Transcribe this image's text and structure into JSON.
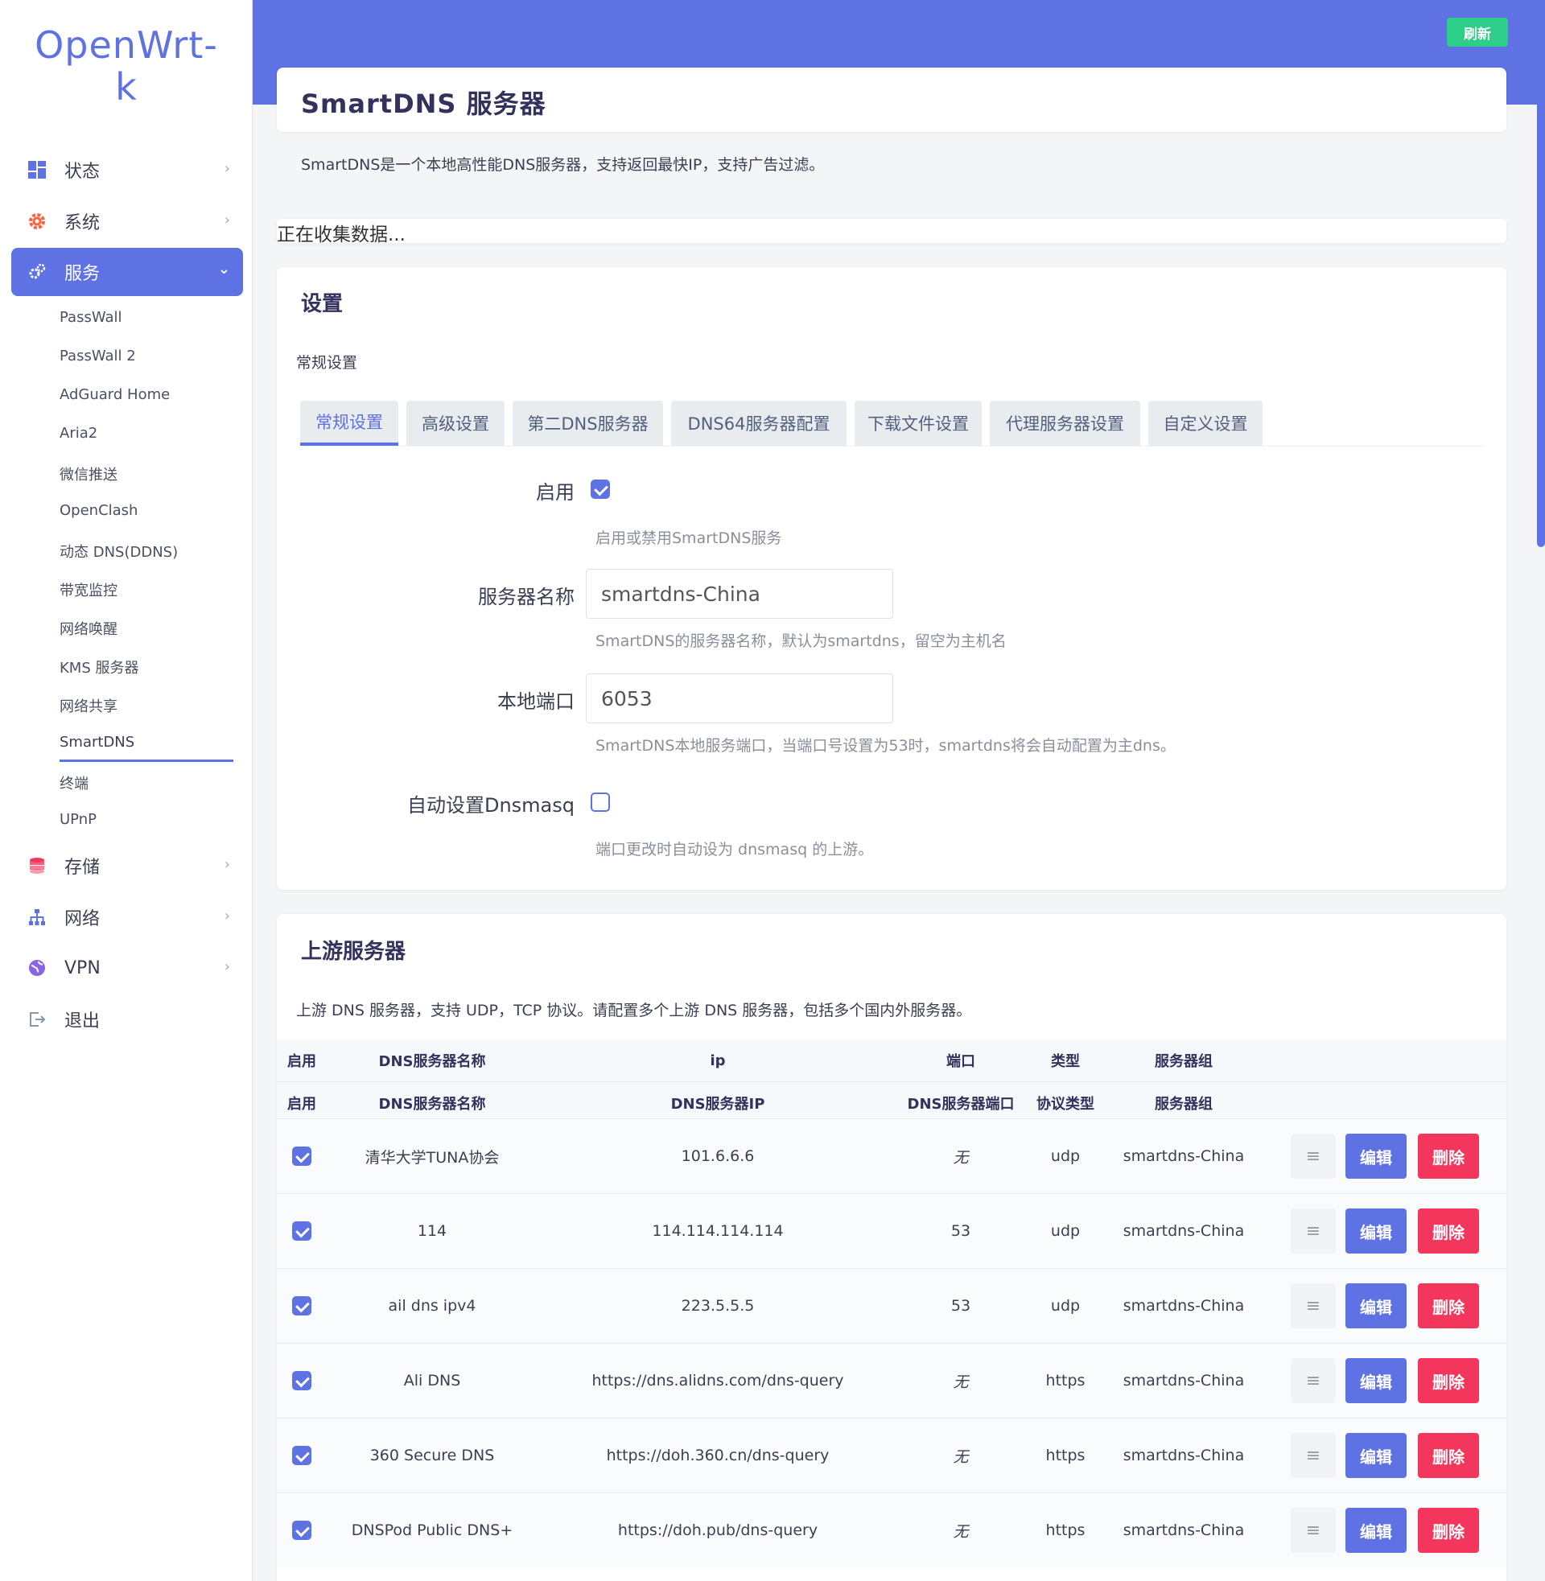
{
  "brand": {
    "line1": "OpenWrt-",
    "line2": "k"
  },
  "nav": {
    "status": "状态",
    "system": "系统",
    "services": "服务",
    "storage": "存储",
    "network": "网络",
    "vpn": "VPN",
    "logout": "退出",
    "services_sub": [
      "PassWall",
      "PassWall 2",
      "AdGuard Home",
      "Aria2",
      "微信推送",
      "OpenClash",
      "动态 DNS(DDNS)",
      "带宽监控",
      "网络唤醒",
      "KMS 服务器",
      "网络共享",
      "SmartDNS",
      "终端",
      "UPnP"
    ]
  },
  "header": {
    "refresh_label": "刷新"
  },
  "page": {
    "title": "SmartDNS 服务器",
    "description": "SmartDNS是一个本地高性能DNS服务器，支持返回最快IP，支持广告过滤。",
    "status": "正在收集数据..."
  },
  "settings": {
    "title": "设置",
    "subtitle": "常规设置",
    "tabs": [
      "常规设置",
      "高级设置",
      "第二DNS服务器",
      "DNS64服务器配置",
      "下载文件设置",
      "代理服务器设置",
      "自定义设置"
    ],
    "active_tab": "常规设置",
    "enable_label": "启用",
    "enable_checked": true,
    "enable_hint": "启用或禁用SmartDNS服务",
    "server_name_label": "服务器名称",
    "server_name_value": "smartdns-China",
    "server_name_hint": "SmartDNS的服务器名称，默认为smartdns，留空为主机名",
    "port_label": "本地端口",
    "port_value": "6053",
    "port_hint": "SmartDNS本地服务端口，当端口号设置为53时，smartdns将会自动配置为主dns。",
    "dnsmasq_label": "自动设置Dnsmasq",
    "dnsmasq_checked": false,
    "dnsmasq_hint": "端口更改时自动设为 dnsmasq 的上游。"
  },
  "upstream": {
    "title": "上游服务器",
    "description": "上游 DNS 服务器，支持 UDP，TCP 协议。请配置多个上游 DNS 服务器，包括多个国内外服务器。",
    "header1": {
      "enable": "启用",
      "name": "DNS服务器名称",
      "ip": "ip",
      "port": "端口",
      "type": "类型",
      "group": "服务器组"
    },
    "header2": {
      "enable": "启用",
      "name": "DNS服务器名称",
      "ip": "DNS服务器IP",
      "port": "DNS服务器端口",
      "type": "协议类型",
      "group": "服务器组"
    },
    "edit_label": "编辑",
    "delete_label": "删除",
    "rows": [
      {
        "enabled": true,
        "name": "清华大学TUNA协会",
        "ip": "101.6.6.6",
        "port": "无",
        "type": "udp",
        "group": "smartdns-China"
      },
      {
        "enabled": true,
        "name": "114",
        "ip": "114.114.114.114",
        "port": "53",
        "type": "udp",
        "group": "smartdns-China"
      },
      {
        "enabled": true,
        "name": "ail dns ipv4",
        "ip": "223.5.5.5",
        "port": "53",
        "type": "udp",
        "group": "smartdns-China"
      },
      {
        "enabled": true,
        "name": "Ali DNS",
        "ip": "https://dns.alidns.com/dns-query",
        "port": "无",
        "type": "https",
        "group": "smartdns-China"
      },
      {
        "enabled": true,
        "name": "360 Secure DNS",
        "ip": "https://doh.360.cn/dns-query",
        "port": "无",
        "type": "https",
        "group": "smartdns-China"
      },
      {
        "enabled": true,
        "name": "DNSPod Public DNS+",
        "ip": "https://doh.pub/dns-query",
        "port": "无",
        "type": "https",
        "group": "smartdns-China"
      }
    ]
  },
  "colors": {
    "accent": "#5e72e4",
    "success": "#2dce89",
    "danger": "#f5365c"
  }
}
